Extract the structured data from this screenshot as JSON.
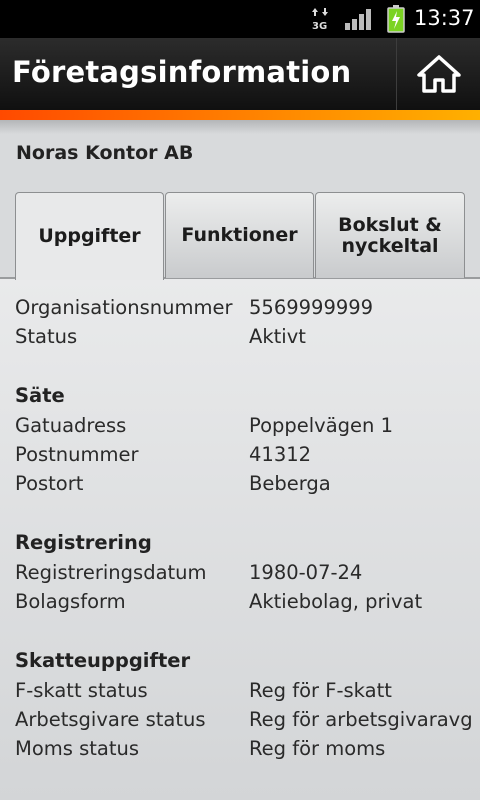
{
  "status_bar": {
    "clock": "13:37",
    "icons": [
      "data-3g-icon",
      "signal-icon",
      "battery-charging-icon"
    ]
  },
  "header": {
    "title": "Företagsinformation",
    "home_icon": "home-icon"
  },
  "company_name": "Noras Kontor AB",
  "tabs": [
    {
      "label": "Uppgifter",
      "active": true
    },
    {
      "label": "Funktioner",
      "active": false
    },
    {
      "label": "Bokslut & nyckeltal",
      "active": false
    }
  ],
  "general": {
    "rows": [
      {
        "label": "Organisationsnummer",
        "value": "5569999999"
      },
      {
        "label": "Status",
        "value": "Aktivt"
      }
    ]
  },
  "sate": {
    "heading": "Säte",
    "rows": [
      {
        "label": "Gatuadress",
        "value": "Poppelvägen 1"
      },
      {
        "label": "Postnummer",
        "value": "41312"
      },
      {
        "label": "Postort",
        "value": "Beberga"
      }
    ]
  },
  "registrering": {
    "heading": "Registrering",
    "rows": [
      {
        "label": "Registreringsdatum",
        "value": "1980-07-24"
      },
      {
        "label": "Bolagsform",
        "value": "Aktiebolag, privat"
      }
    ]
  },
  "skatt": {
    "heading": "Skatteuppgifter",
    "rows": [
      {
        "label": "F-skatt status",
        "value": "Reg för F-skatt"
      },
      {
        "label": "Arbetsgivare status",
        "value": "Reg för arbetsgivaravg"
      },
      {
        "label": "Moms status",
        "value": "Reg för moms"
      }
    ]
  },
  "colors": {
    "accent_start": "#ff4a00",
    "accent_end": "#ffb000",
    "battery_green": "#7bd322"
  }
}
